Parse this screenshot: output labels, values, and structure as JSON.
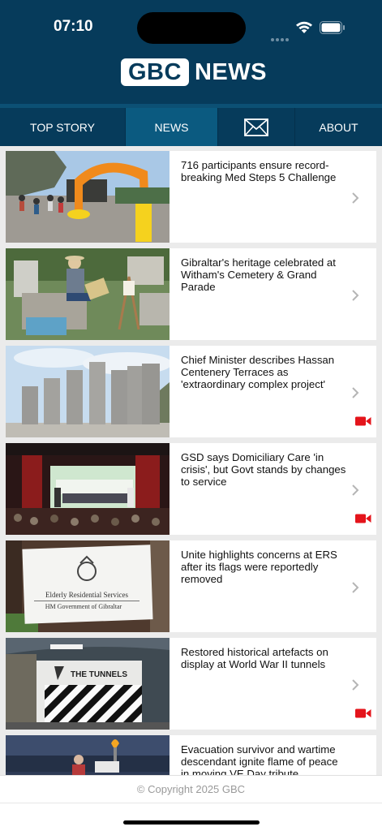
{
  "status_bar": {
    "time": "07:10"
  },
  "logo": {
    "box_text": "GBC",
    "word": "NEWS"
  },
  "tabs": [
    {
      "label": "TOP STORY"
    },
    {
      "label": "NEWS"
    },
    {
      "label": "",
      "icon": "envelope-icon"
    },
    {
      "label": "ABOUT"
    }
  ],
  "articles": [
    {
      "headline": "716 participants ensure record-breaking Med Steps 5 Challenge",
      "video": false
    },
    {
      "headline": "Gibraltar's heritage celebrated at Witham's Cemetery & Grand Parade",
      "video": false
    },
    {
      "headline": "Chief Minister describes Hassan Centenery Terraces as 'extraordinary complex project'",
      "video": true
    },
    {
      "headline": "GSD says Domiciliary Care 'in crisis', but Govt stands by changes to service",
      "video": true
    },
    {
      "headline": "Unite highlights concerns at ERS after its flags were reportedly removed",
      "video": false
    },
    {
      "headline": "Restored historical artefacts on display at World War II tunnels",
      "video": true
    },
    {
      "headline": "Evacuation survivor and wartime descendant ignite flame of peace in moving VE Day tribute",
      "video": false
    }
  ],
  "images": {
    "sign_line1": "Elderly Residential Services",
    "sign_line2": "HM Government of Gibraltar",
    "tunnels_title": "THE TUNNELS"
  },
  "footer": {
    "copyright": "© Copyright 2025 GBC"
  },
  "colors": {
    "header": "#063b5b",
    "active_tab": "#0b5a80",
    "video_icon": "#e4141b"
  }
}
